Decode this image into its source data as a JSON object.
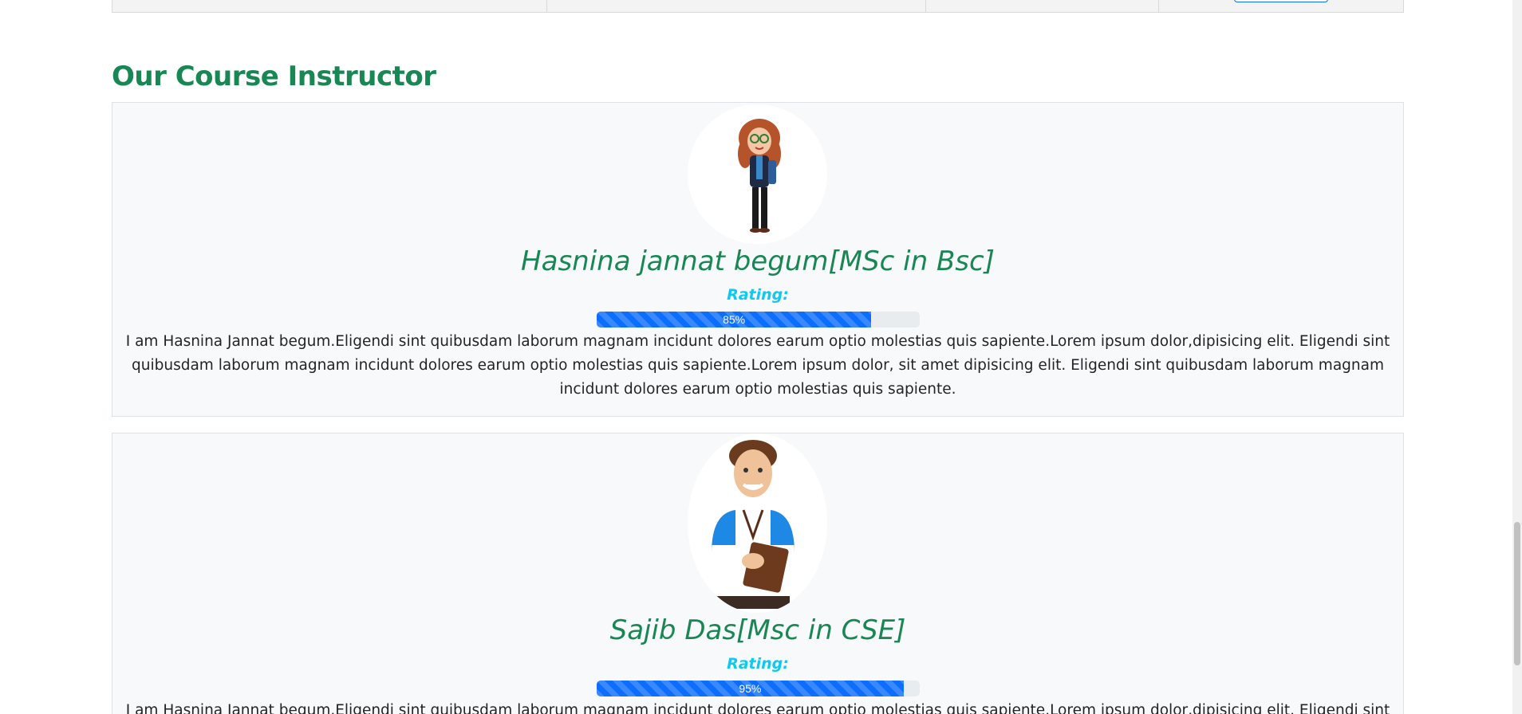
{
  "section": {
    "title": "Our Course Instructor"
  },
  "instructors": [
    {
      "name": "Hasnina jannat begum[MSc in Bsc]",
      "rating_label": "Rating:",
      "rating_text": "85%",
      "rating_percent": 85,
      "bio": "I am Hasnina Jannat begum.Eligendi sint quibusdam laborum magnam incidunt dolores earum optio molestias quis sapiente.Lorem ipsum dolor,dipisicing elit. Eligendi sint quibusdam laborum magnam incidunt dolores earum optio molestias quis sapiente.Lorem ipsum dolor, sit amet dipisicing elit. Eligendi sint quibusdam laborum magnam incidunt dolores earum optio molestias quis sapiente."
    },
    {
      "name": "Sajib Das[Msc in CSE]",
      "rating_label": "Rating:",
      "rating_text": "95%",
      "rating_percent": 95,
      "bio": "I am Hasnina Jannat begum.Eligendi sint quibusdam laborum magnam incidunt dolores earum optio molestias quis sapiente.Lorem ipsum dolor,dipisicing elit. Eligendi sint quibusdam"
    }
  ],
  "colors": {
    "heading": "#198754",
    "rating_label": "#0dcaf0",
    "progress": "#0d6efd"
  },
  "scroll": {
    "position_percent": 73
  }
}
